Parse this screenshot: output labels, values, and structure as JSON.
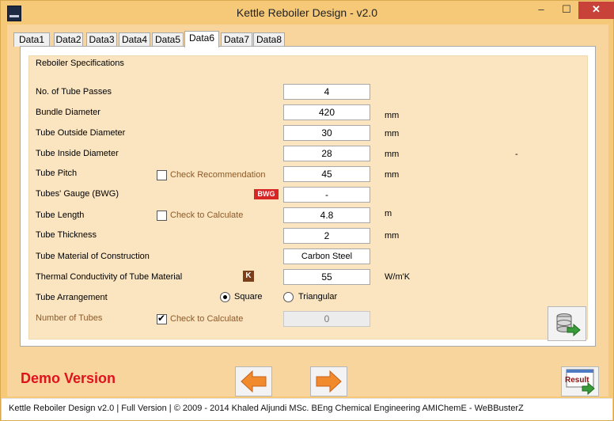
{
  "window": {
    "title": "Kettle Reboiler Design - v2.0",
    "min": "‒",
    "max": "☐",
    "close": "✕"
  },
  "tabs": [
    {
      "label": "Data1"
    },
    {
      "label": "Data2"
    },
    {
      "label": "Data3"
    },
    {
      "label": "Data4"
    },
    {
      "label": "Data5"
    },
    {
      "label": "Data6"
    },
    {
      "label": "Data7"
    },
    {
      "label": "Data8"
    }
  ],
  "active_tab": "Data6",
  "group": {
    "title": "Reboiler Specifications"
  },
  "fields": {
    "passes": {
      "label": "No. of Tube Passes",
      "value": "4",
      "unit": ""
    },
    "bundle": {
      "label": "Bundle Diameter",
      "value": "420",
      "unit": "mm"
    },
    "outside": {
      "label": "Tube Outside Diameter",
      "value": "30",
      "unit": "mm"
    },
    "inside": {
      "label": "Tube Inside Diameter",
      "value": "28",
      "unit": "mm"
    },
    "pitch": {
      "label": "Tube Pitch",
      "value": "45",
      "unit": "mm"
    },
    "gauge": {
      "label": "Tubes' Gauge (BWG)",
      "value": "-",
      "unit": ""
    },
    "length": {
      "label": "Tube Length",
      "value": "4.8",
      "unit": "m"
    },
    "thickness": {
      "label": "Tube Thickness",
      "value": "2",
      "unit": "mm"
    },
    "material": {
      "label": "Tube Material of Construction",
      "value": "Carbon Steel",
      "unit": ""
    },
    "conductivity": {
      "label": "Thermal Conductivity of Tube Material",
      "value": "55",
      "unit": "W/m'K"
    },
    "arrangement": {
      "label": "Tube Arrangement"
    },
    "num_tubes": {
      "label": "Number of Tubes",
      "value": "0"
    }
  },
  "stray_mark": "-",
  "checkboxes": {
    "pitch_recommend": {
      "label": "Check Recommendation",
      "checked": false
    },
    "length_calc": {
      "label": "Check to Calculate",
      "checked": false
    },
    "tubes_calc": {
      "label": "Check to Calculate",
      "checked": true
    }
  },
  "radios": {
    "square": {
      "label": "Square",
      "checked": true
    },
    "triangular": {
      "label": "Triangular",
      "checked": false
    }
  },
  "badges": {
    "bwg": "BWG",
    "k": "K"
  },
  "buttons": {
    "result": "Result"
  },
  "demo_text": "Demo Version",
  "status": "Kettle Reboiler Design  v2.0  |  Full Version  |  © 2009 - 2014 Khaled Aljundi MSc. BEng Chemical Engineering AMIChemE - WeBBusterZ",
  "colors": {
    "frame": "#f5c977",
    "panel": "#fbe5c0",
    "demo": "#e0121e",
    "arrow": "#f08a2c",
    "accent_green": "#3a9b3a"
  }
}
